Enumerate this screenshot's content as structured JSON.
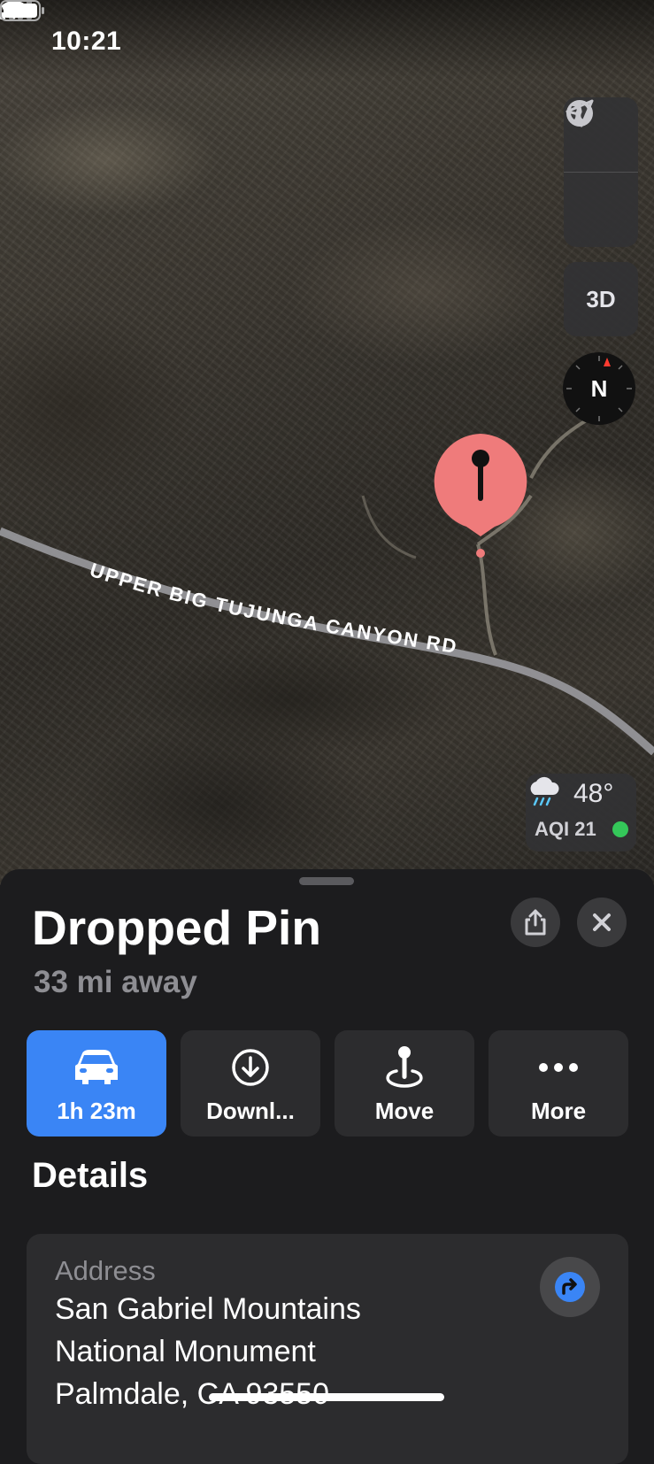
{
  "status_bar": {
    "time": "10:21",
    "location_icon": "location-arrow-icon",
    "signal_icon": "cellular-signal-icon",
    "wifi_icon": "wifi-icon",
    "battery_icon": "battery-icon"
  },
  "map": {
    "road_label": "UPPER BIG TUJUNGA CANYON RD",
    "controls": {
      "map_mode_icon": "globe-icon",
      "track_location_icon": "location-arrow-icon",
      "view_3d_label": "3D",
      "compass_label": "N"
    },
    "pin_color": "#ef7b7b",
    "weather": {
      "icon": "cloud-rain-icon",
      "temperature": "48°",
      "aqi": "AQI 21",
      "aqi_color": "#34c759"
    }
  },
  "sheet": {
    "title": "Dropped Pin",
    "distance": "33 mi away",
    "share_icon": "share-icon",
    "close_icon": "close-icon",
    "actions": [
      {
        "label": "1h 23m",
        "icon": "car-icon",
        "primary": true,
        "color": "#3a85f5"
      },
      {
        "label": "Downl...",
        "icon": "download-icon"
      },
      {
        "label": "Move",
        "icon": "move-pin-icon"
      },
      {
        "label": "More",
        "icon": "more-icon"
      }
    ],
    "details_heading": "Details",
    "address": {
      "label": "Address",
      "lines": [
        "San Gabriel Mountains",
        "National Monument",
        "Palmdale, CA  93550"
      ],
      "directions_icon": "directions-arrow-icon",
      "directions_color": "#3a85f5"
    }
  }
}
